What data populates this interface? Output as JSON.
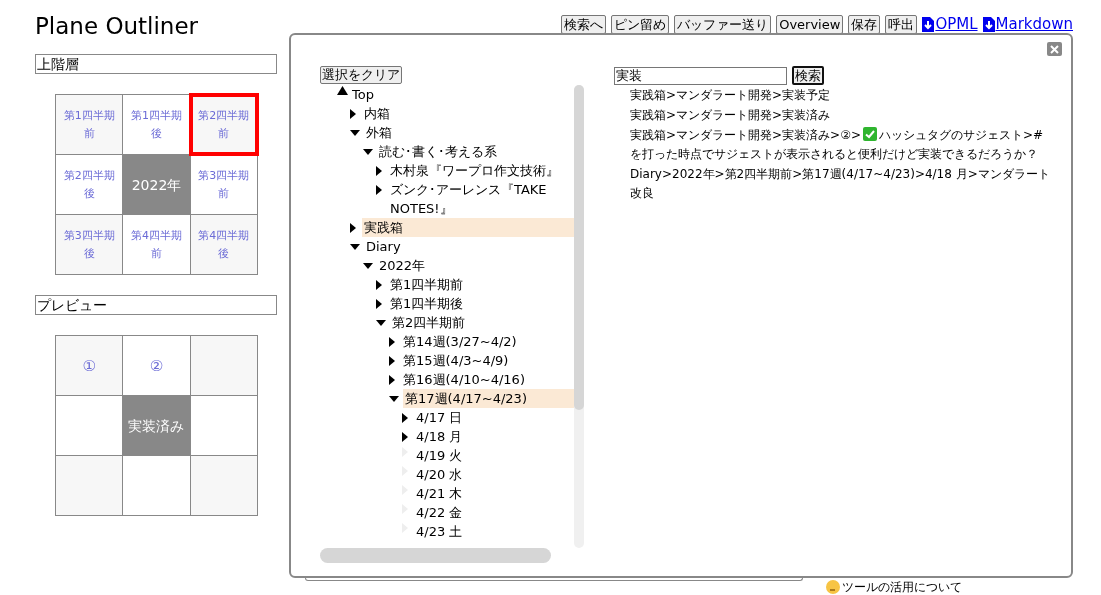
{
  "app_title": "Plane Outliner",
  "upper_level": {
    "heading": "上階層",
    "cells": [
      {
        "kind": "cell",
        "label": "第1四半期前",
        "selected": false
      },
      {
        "kind": "cell",
        "label": "第1四半期後",
        "selected": false
      },
      {
        "kind": "cell",
        "label": "第2四半期前",
        "selected": true
      },
      {
        "kind": "cell",
        "label": "第2四半期後",
        "selected": false
      },
      {
        "kind": "cell",
        "label": "第3四半期前",
        "selected": false
      },
      {
        "kind": "cell",
        "label": "第3四半期後",
        "selected": false
      },
      {
        "kind": "cell",
        "label": "第4四半期前",
        "selected": false
      },
      {
        "kind": "cell",
        "label": "第4四半期後",
        "selected": false
      }
    ],
    "center": {
      "label": "2022年"
    }
  },
  "preview": {
    "heading": "プレビュー",
    "cells": [
      {
        "kind": "cell",
        "label": "①",
        "selected": false
      },
      {
        "kind": "cell",
        "label": "②",
        "selected": false
      },
      {
        "kind": "cell",
        "selected": false
      },
      {
        "kind": "cell",
        "selected": false
      },
      {
        "kind": "cell",
        "selected": false
      },
      {
        "kind": "cell",
        "selected": false
      },
      {
        "kind": "cell",
        "selected": false
      },
      {
        "kind": "cell",
        "selected": false
      }
    ],
    "center": {
      "label": "実装済み"
    }
  },
  "toolbar": {
    "buttons": [
      "検索へ",
      "ピン留め",
      "バッファー送り",
      "Overview",
      "保存",
      "呼出"
    ],
    "links": [
      "OPML",
      "Markdown"
    ]
  },
  "bottom_note": "ツールの活用について",
  "dialog": {
    "clear_button": "選択をクリア",
    "tree": {
      "label": "Top",
      "kind": "root",
      "expanded": true,
      "selected": false,
      "children": [
        {
          "label": "内箱",
          "kind": "branch",
          "expanded": false,
          "selected": false
        },
        {
          "label": "外箱",
          "kind": "branch",
          "expanded": true,
          "selected": false,
          "children": [
            {
              "label": "読む･書く･考える系",
              "kind": "branch",
              "expanded": true,
              "selected": false,
              "children": [
                {
                  "label": "木村泉『ワープロ作文技術』",
                  "kind": "branch",
                  "expanded": false,
                  "selected": false
                },
                {
                  "label": "ズンク･アーレンス『TAKE NOTES!』",
                  "kind": "branch",
                  "expanded": false,
                  "selected": false
                }
              ]
            }
          ]
        },
        {
          "label": "実践箱",
          "kind": "branch",
          "expanded": false,
          "selected": true
        },
        {
          "label": "Diary",
          "kind": "branch",
          "expanded": true,
          "selected": false,
          "children": [
            {
              "label": "2022年",
              "kind": "branch",
              "expanded": true,
              "selected": false,
              "children": [
                {
                  "label": "第1四半期前",
                  "kind": "branch",
                  "expanded": false,
                  "selected": false
                },
                {
                  "label": "第1四半期後",
                  "kind": "branch",
                  "expanded": false,
                  "selected": false
                },
                {
                  "label": "第2四半期前",
                  "kind": "branch",
                  "expanded": true,
                  "selected": false,
                  "children": [
                    {
                      "label": "第14週(3/27~4/2)",
                      "kind": "branch",
                      "expanded": false,
                      "selected": false
                    },
                    {
                      "label": "第15週(4/3~4/9)",
                      "kind": "branch",
                      "expanded": false,
                      "selected": false
                    },
                    {
                      "label": "第16週(4/10~4/16)",
                      "kind": "branch",
                      "expanded": false,
                      "selected": false
                    },
                    {
                      "label": "第17週(4/17~4/23)",
                      "kind": "branch",
                      "expanded": true,
                      "selected": true,
                      "children": [
                        {
                          "label": "4/17 日",
                          "kind": "branch",
                          "expanded": false,
                          "selected": false
                        },
                        {
                          "label": "4/18 月",
                          "kind": "branch",
                          "expanded": false,
                          "selected": false
                        },
                        {
                          "label": "4/19 火",
                          "kind": "leaf",
                          "expanded": false,
                          "selected": false
                        },
                        {
                          "label": "4/20 水",
                          "kind": "leaf",
                          "expanded": false,
                          "selected": false
                        },
                        {
                          "label": "4/21 木",
                          "kind": "leaf",
                          "expanded": false,
                          "selected": false
                        },
                        {
                          "label": "4/22 金",
                          "kind": "leaf",
                          "expanded": false,
                          "selected": false
                        },
                        {
                          "label": "4/23 土",
                          "kind": "leaf",
                          "expanded": false,
                          "selected": false
                        }
                      ]
                    }
                  ]
                }
              ]
            }
          ]
        }
      ]
    },
    "search": {
      "value": "実装",
      "button": "検索"
    },
    "results": [
      {
        "parts": [
          "実践箱>マンダラート開発>実装予定"
        ]
      },
      {
        "parts": [
          "実践箱>マンダラート開発>実装済み"
        ]
      },
      {
        "parts": [
          "実践箱>マンダラート開発>実装済み>②>",
          "ハッシュタグのサジェスト>#を打った時点でサジェストが表示されると便利だけど実装できるだろうか？"
        ]
      },
      {
        "parts": [
          "Diary>2022年>第2四半期前>第17週(4/17~4/23)>4/18 月>マンダラート改良"
        ]
      }
    ]
  }
}
